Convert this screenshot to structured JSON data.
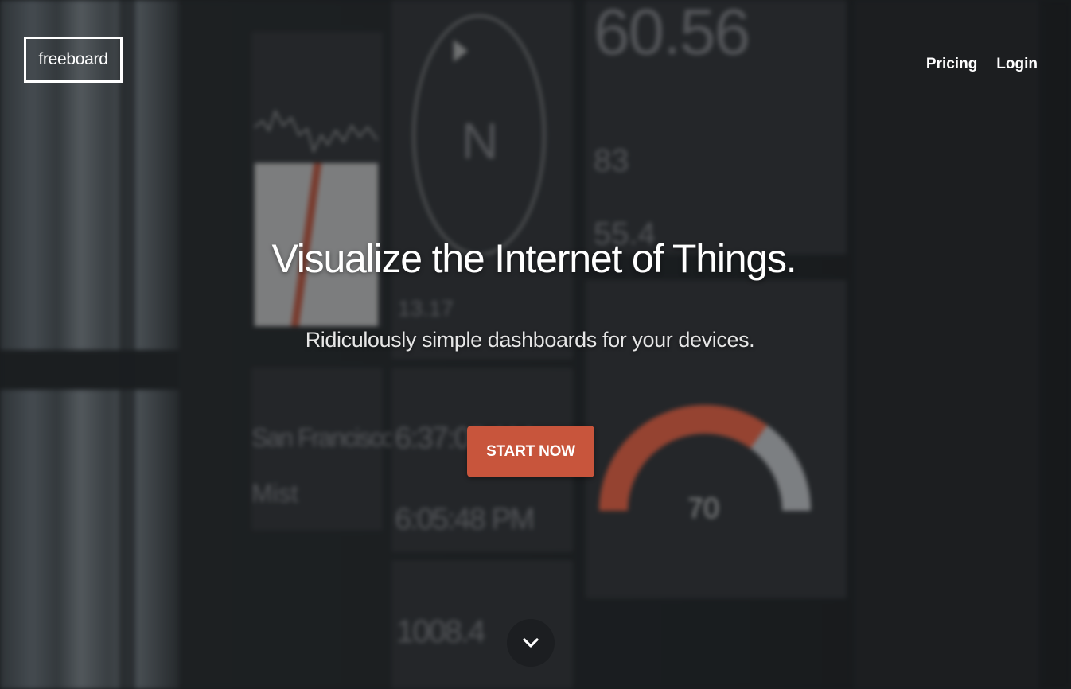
{
  "header": {
    "logo_text": "freeboard",
    "nav": [
      {
        "label": "Pricing"
      },
      {
        "label": "Login"
      }
    ]
  },
  "hero": {
    "title": "Visualize the Internet of Things.",
    "subtitle": "Ridiculously simple dashboards for your devices.",
    "cta_label": "START NOW"
  },
  "background_dashboard": {
    "temperature": "60.56",
    "high_value": "83",
    "low_value": "55.4",
    "compass_heading": "N",
    "speed_value": "13.17",
    "location": "San Francisco",
    "weather": "Mist",
    "sunrise_time": "6:37:05 AM",
    "sunset_time": "6:05:48 PM",
    "gauge_value": "70",
    "pressure_value": "1008.4",
    "gauge_fraction": 0.7
  },
  "colors": {
    "accent": "#c8553c",
    "gauge_rest": "#a6a8ac",
    "panel": "#2b2d31",
    "text": "#ffffff"
  },
  "icons": {
    "scroll_down": "chevron-down-icon"
  }
}
